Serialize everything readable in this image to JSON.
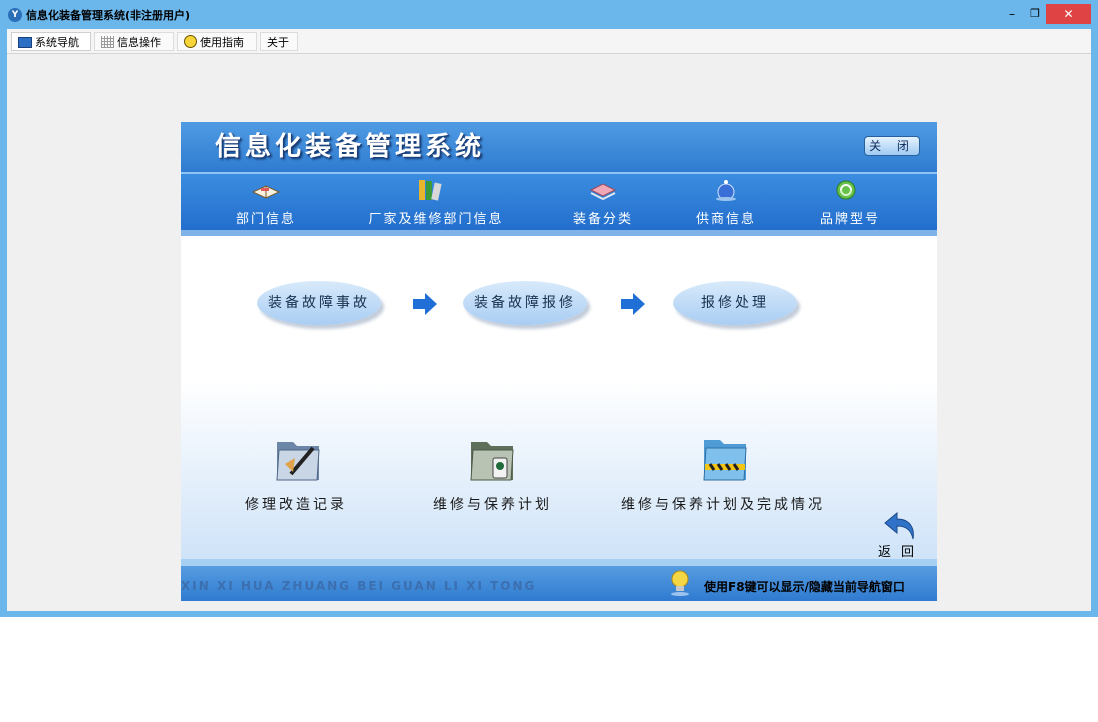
{
  "window": {
    "title": "信息化装备管理系统(非注册用户)",
    "controls": {
      "minimize": "–",
      "restore": "❐",
      "close": "✕"
    }
  },
  "menu": {
    "tabs": [
      {
        "label": "系统导航",
        "icon": "monitor-icon"
      },
      {
        "label": "信息操作",
        "icon": "grid-icon"
      },
      {
        "label": "使用指南",
        "icon": "lightbulb-icon"
      },
      {
        "label": "关于"
      }
    ]
  },
  "panel": {
    "title": "信息化装备管理系统",
    "close_button": "关 闭",
    "nav_items": [
      {
        "label": "部门信息",
        "icon": "book-icon"
      },
      {
        "label": "厂家及维修部门信息",
        "icon": "books-icon"
      },
      {
        "label": "装备分类",
        "icon": "folder-stack-icon"
      },
      {
        "label": "供商信息",
        "icon": "globe-icon"
      },
      {
        "label": "品牌型号",
        "icon": "recycle-icon"
      }
    ],
    "flow": [
      "装备故障事故",
      "装备故障报修",
      "报修处理"
    ],
    "shortcuts": [
      {
        "label": "修理改造记录",
        "icon": "folder-pen-icon"
      },
      {
        "label": "维修与保养计划",
        "icon": "folder-cup-icon"
      },
      {
        "label": "维修与保养计划及完成情况",
        "icon": "folder-caution-icon"
      }
    ],
    "return_label": "返回",
    "footer_pinyin": "XIN XI HUA ZHUANG BEI GUAN LI XI TONG",
    "footer_hint": "使用F8键可以显示/隐藏当前导航窗口"
  },
  "colors": {
    "titlebar": "#6bb7ec",
    "banner": "#2f7bd0",
    "close_red": "#e04343"
  }
}
